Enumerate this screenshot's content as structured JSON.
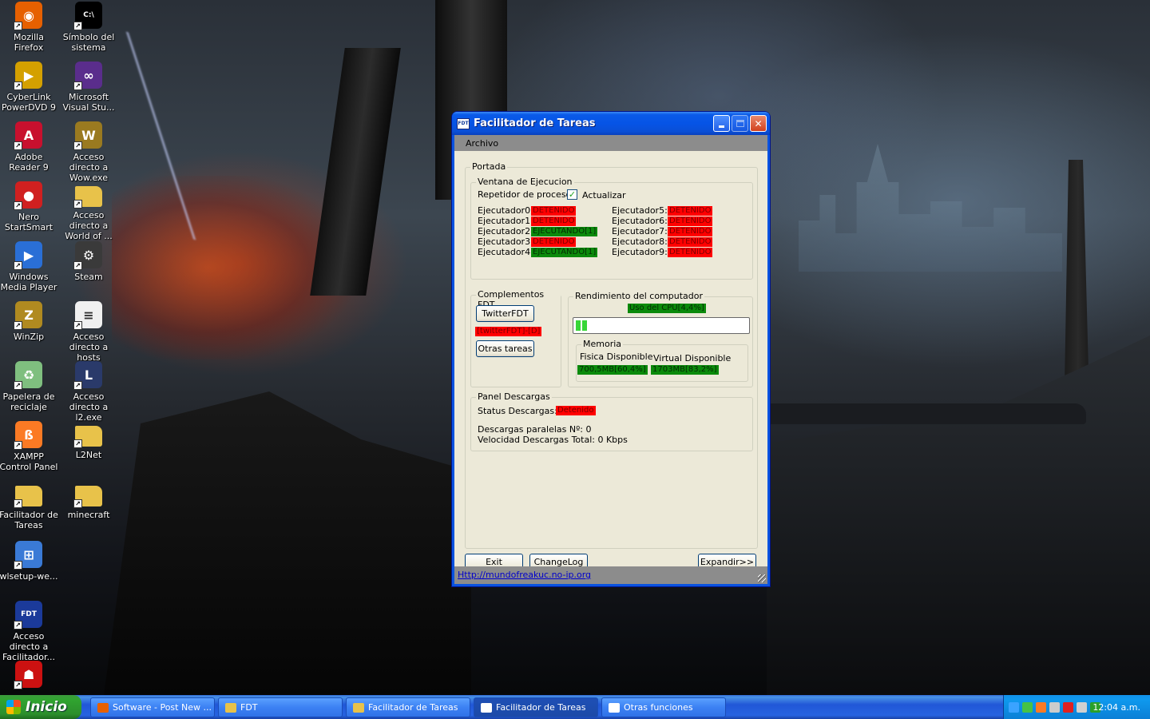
{
  "desktop": {
    "icons": [
      {
        "label": "Mozilla Firefox",
        "icon": "firefox-icon",
        "color": "#e66000",
        "glyph": "◉"
      },
      {
        "label": "Símbolo del sistema",
        "icon": "command-prompt-icon",
        "color": "#000000",
        "glyph": "C:\\"
      },
      {
        "label": "CyberLink PowerDVD 9",
        "icon": "powerdvd-icon",
        "color": "#d4a000",
        "glyph": "▶"
      },
      {
        "label": "Microsoft Visual Stu...",
        "icon": "visual-studio-icon",
        "color": "#5a2d8c",
        "glyph": "∞"
      },
      {
        "label": "Adobe Reader 9",
        "icon": "adobe-reader-icon",
        "color": "#c8102e",
        "glyph": "A"
      },
      {
        "label": "Acceso directo a Wow.exe",
        "icon": "wow-icon",
        "color": "#9a7a20",
        "glyph": "W"
      },
      {
        "label": "Nero StartSmart",
        "icon": "nero-icon",
        "color": "#d02020",
        "glyph": "●"
      },
      {
        "label": "Acceso directo a World of ...",
        "icon": "folder-icon",
        "color": "#e8c24a",
        "glyph": ""
      },
      {
        "label": "Windows Media Player",
        "icon": "media-player-icon",
        "color": "#2a6fd6",
        "glyph": "▶"
      },
      {
        "label": "Steam",
        "icon": "steam-icon",
        "color": "#3a3a3a",
        "glyph": "⚙"
      },
      {
        "label": "WinZip",
        "icon": "winzip-icon",
        "color": "#b08a20",
        "glyph": "Z"
      },
      {
        "label": "Acceso directo a hosts",
        "icon": "file-icon",
        "color": "#f0f0f0",
        "glyph": "≡"
      },
      {
        "label": "Papelera de reciclaje",
        "icon": "recycle-bin-icon",
        "color": "#7fbf7f",
        "glyph": "♻"
      },
      {
        "label": "Acceso directo a l2.exe",
        "icon": "lineage-icon",
        "color": "#2a3a6a",
        "glyph": "L"
      },
      {
        "label": "XAMPP Control Panel",
        "icon": "xampp-icon",
        "color": "#fb7a24",
        "glyph": "ß"
      },
      {
        "label": "L2Net",
        "icon": "folder-icon",
        "color": "#e8c24a",
        "glyph": ""
      },
      {
        "label": "Facilitador de Tareas",
        "icon": "folder-icon",
        "color": "#e8c24a",
        "glyph": ""
      },
      {
        "label": "minecraft",
        "icon": "folder-icon",
        "color": "#e8c24a",
        "glyph": ""
      },
      {
        "label": "wlsetup-we...",
        "icon": "windows-live-icon",
        "color": "#3a7ad6",
        "glyph": "⊞"
      },
      {
        "label": "Acceso directo a Facilitador...",
        "icon": "fdt-icon",
        "color": "#1b3a9a",
        "glyph": "FDT"
      },
      {
        "label": "",
        "icon": "red-figure-icon",
        "color": "#cc1111",
        "glyph": "☗"
      }
    ]
  },
  "window": {
    "title": "Facilitador de Tareas",
    "app_icon_text": "FDT",
    "menu": [
      "Archivo"
    ],
    "portada": {
      "label": "Portada",
      "ventana": {
        "label": "Ventana de Ejecucion",
        "repetidor_label": "Repetidor de proceso",
        "actualizar_label": "Actualizar",
        "actualizar_checked": true,
        "ejecutadores_left": [
          {
            "name": "Ejecutador0:",
            "status": "DETENIDO",
            "state": "red"
          },
          {
            "name": "Ejecutador1:",
            "status": "DETENIDO",
            "state": "red"
          },
          {
            "name": "Ejecutador2:",
            "status": "EJECUTANDO[1]",
            "state": "green"
          },
          {
            "name": "Ejecutador3:",
            "status": "DETENIDO",
            "state": "red"
          },
          {
            "name": "Ejecutador4:",
            "status": "EJECUTANDO[1]",
            "state": "green"
          }
        ],
        "ejecutadores_right": [
          {
            "name": "Ejecutador5:",
            "status": "DETENIDO",
            "state": "red"
          },
          {
            "name": "Ejecutador6:",
            "status": "DETENIDO",
            "state": "red"
          },
          {
            "name": "Ejecutador7:",
            "status": "DETENIDO",
            "state": "red"
          },
          {
            "name": "Ejecutador8:",
            "status": "DETENIDO",
            "state": "red"
          },
          {
            "name": "Ejecutador9:",
            "status": "DETENIDO",
            "state": "red"
          }
        ]
      },
      "complementos": {
        "label": "Complementos FDT",
        "twitter_button": "TwitterFDT",
        "twitter_status": "[twitterFDT]-[D]",
        "otras_button": "Otras tareas"
      },
      "rendimiento": {
        "label": "Rendimiento del computador",
        "cpu_label": "Uso del CPU[4,4%]",
        "cpu_percent": 4.4,
        "memoria_label": "Memoria",
        "fisica_label": "Fisica Disponible",
        "fisica_value": "700,5MB[60,4%]",
        "virtual_label": "Virtual Disponible",
        "virtual_value": "1703MB[83,2%]"
      },
      "descargas": {
        "label": "Panel Descargas",
        "status_label": "Status Descargas:",
        "status_value": "Detenido",
        "paralelas": "Descargas paralelas Nº: 0",
        "velocidad": "Velocidad Descargas Total: 0 Kbps"
      }
    },
    "buttons": {
      "exit": "Exit",
      "changelog": "ChangeLog",
      "expandir": "Expandir>>"
    },
    "status_link": "Http://mundofreakuc.no-ip.org"
  },
  "taskbar": {
    "start_label": "Inicio",
    "tasks": [
      {
        "label": "Software - Post New ...",
        "icon_color": "#e66000",
        "active": false
      },
      {
        "label": "FDT",
        "icon_color": "#e8c24a",
        "active": false
      },
      {
        "label": "Facilitador de Tareas",
        "icon_color": "#e8c24a",
        "active": false
      },
      {
        "label": "Facilitador de Tareas",
        "icon_color": "#ffffff",
        "active": true
      },
      {
        "label": "Otras funciones",
        "icon_color": "#ffffff",
        "active": false
      }
    ],
    "tray_icon_colors": [
      "#3aa3ff",
      "#46c246",
      "#fb7a24",
      "#cccccc",
      "#e02020",
      "#d0d0d0",
      "#2aa02a"
    ],
    "clock": "12:04 a.m."
  },
  "colors": {
    "status_red": "#ff0000",
    "status_green": "#0b8a0b",
    "xp_blue": "#0a53e0"
  }
}
